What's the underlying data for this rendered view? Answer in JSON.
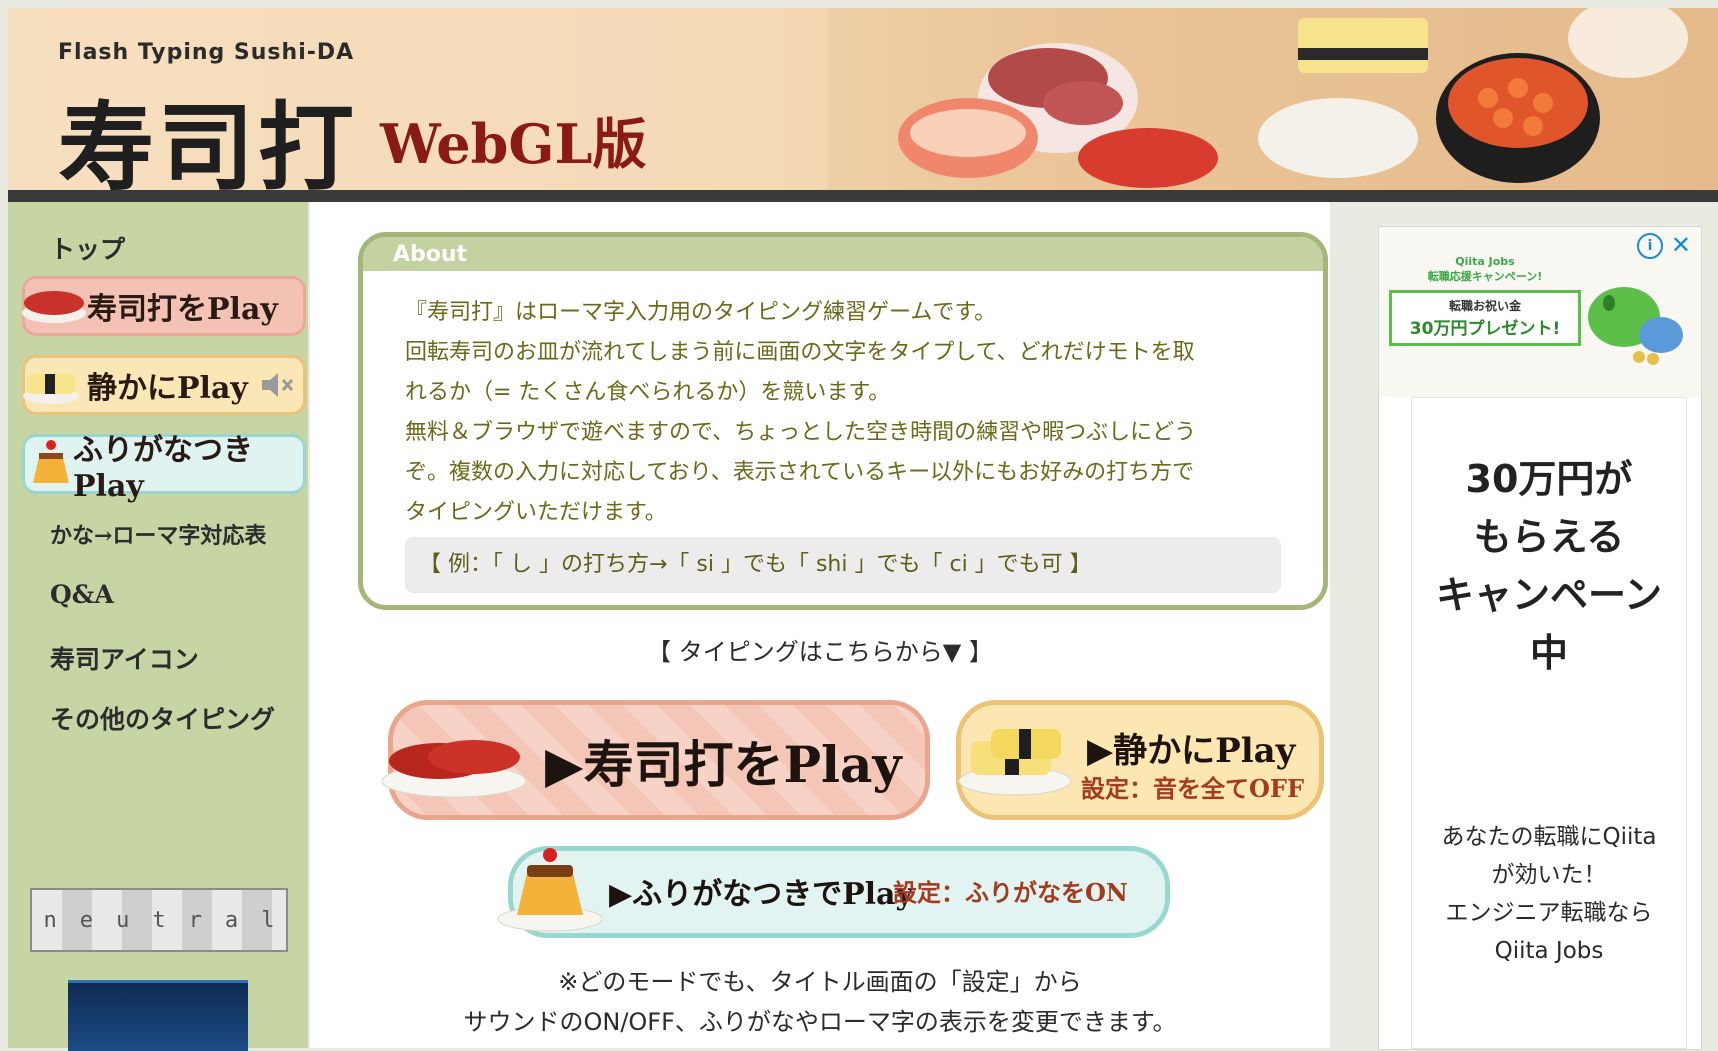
{
  "header": {
    "subtitle": "Flash Typing Sushi-DA",
    "logo": "寿司打",
    "edition": "WebGL版"
  },
  "sidebar": {
    "top": "トップ",
    "play_buttons": [
      {
        "label": "寿司打をPlay",
        "icon": "sushi-tuna-icon"
      },
      {
        "label": "静かにPlay",
        "icon": "tamago-sushi-icon",
        "extra_icon": "speaker-muted-icon"
      },
      {
        "label": "ふりがなつきPlay",
        "icon": "pudding-icon"
      }
    ],
    "links": [
      "かな→ローマ字対応表",
      "Q&A",
      "寿司アイコン",
      "その他のタイピング"
    ],
    "banner_text": [
      "n",
      "e",
      "u",
      "t",
      "r",
      "a",
      "l"
    ]
  },
  "about": {
    "heading": "About",
    "lines": [
      "『寿司打』はローマ字入力用のタイピング練習ゲームです。",
      "回転寿司のお皿が流れてしまう前に画面の文字をタイプして、どれだけモトを取",
      "れるか（= たくさん食べられるか）を競います。",
      "無料＆ブラウザで遊べますので、ちょっとした空き時間の練習や暇つぶしにどう",
      "ぞ。複数の入力に対応しており、表示されているキー以外にもお好みの打ち方で",
      "タイピングいただけます。"
    ],
    "example": "【 例：「 し 」の打ち方→「 si 」でも「 shi 」でも「 ci 」でも可 】"
  },
  "typing": {
    "title": "【 タイピングはこちらから▼ 】",
    "main_play": "▶寿司打をPlay",
    "quiet_play": "▶静かにPlay",
    "quiet_setting": "設定：音を全てOFF",
    "furigana_play": "▶ふりがなつきでPlay",
    "furigana_setting": "設定：ふりがなをON",
    "note_lines": [
      "※どのモードでも、タイトル画面の「設定」から",
      "サウンドのON/OFF、ふりがなやローマ字の表示を変更できます。"
    ]
  },
  "ad": {
    "info": "i",
    "close": "✕",
    "brand": "Qiita Jobs",
    "campaign": "転職応援キャンペーン!",
    "gift_label": "転職お祝い金",
    "gift_amount": "30万円プレゼント!",
    "headline_lines": [
      "30万円が",
      "もらえる",
      "キャンペーン",
      "中"
    ],
    "desc_lines": [
      "あなたの転職にQiita",
      "が効いた！",
      "エンジニア転職なら",
      "Qiita Jobs"
    ]
  },
  "colors": {
    "sidebar_bg": "#c7d5a5",
    "about_border": "#a5b67a",
    "about_text": "#6b6a1a",
    "brand_red": "#8a1a14"
  }
}
